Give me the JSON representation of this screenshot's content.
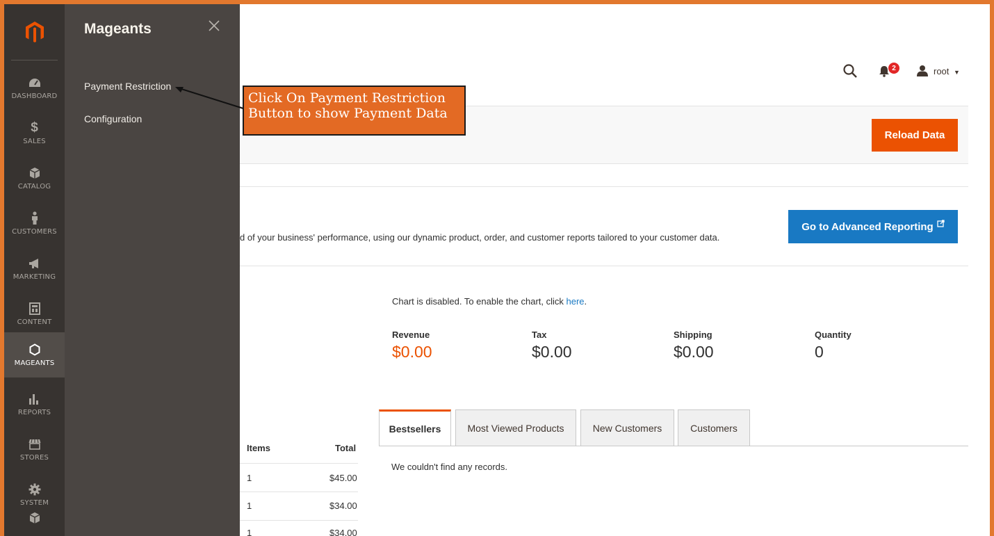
{
  "panel": {
    "title": "Mageants",
    "links": [
      "Payment Restriction",
      "Configuration"
    ]
  },
  "nav": {
    "items": [
      {
        "label": "DASHBOARD",
        "icon": "dashboard-icon"
      },
      {
        "label": "SALES",
        "icon": "dollar-icon"
      },
      {
        "label": "CATALOG",
        "icon": "box-icon"
      },
      {
        "label": "CUSTOMERS",
        "icon": "person-icon"
      },
      {
        "label": "MARKETING",
        "icon": "megaphone-icon"
      },
      {
        "label": "CONTENT",
        "icon": "layout-icon"
      },
      {
        "label": "MAGEANTS",
        "icon": "hexagon-icon"
      },
      {
        "label": "REPORTS",
        "icon": "bar-chart-icon"
      },
      {
        "label": "STORES",
        "icon": "storefront-icon"
      },
      {
        "label": "SYSTEM",
        "icon": "gear-icon"
      }
    ],
    "active": "MAGEANTS"
  },
  "header": {
    "notification_count": "2",
    "user": "root"
  },
  "actions": {
    "reload": "Reload Data"
  },
  "intro": {
    "text": "d of your business' performance, using our dynamic product, order, and customer reports tailored to your customer data.",
    "advanced_button": "Go to Advanced Reporting"
  },
  "chart": {
    "message": "Chart is disabled. To enable the chart, click ",
    "link": "here",
    "end": "."
  },
  "totals": [
    {
      "label": "Revenue",
      "value": "$0.00"
    },
    {
      "label": "Tax",
      "value": "$0.00"
    },
    {
      "label": "Shipping",
      "value": "$0.00"
    },
    {
      "label": "Quantity",
      "value": "0"
    }
  ],
  "tabs": [
    "Bestsellers",
    "Most Viewed Products",
    "New Customers",
    "Customers"
  ],
  "tab_content": "We couldn't find any records.",
  "orders": {
    "headers": [
      "Items",
      "Total"
    ],
    "rows": [
      {
        "items": "1",
        "total": "$45.00"
      },
      {
        "items": "1",
        "total": "$34.00"
      },
      {
        "items": "1",
        "total": "$34.00"
      }
    ]
  },
  "callout": {
    "line1": "Click On Payment Restriction",
    "line2": "Button to show Payment Data"
  },
  "colors": {
    "accent": "#eb5202",
    "frame": "#e2782e",
    "link": "#1979c3",
    "nav_bg": "#373330",
    "panel_bg": "#4a4542"
  }
}
